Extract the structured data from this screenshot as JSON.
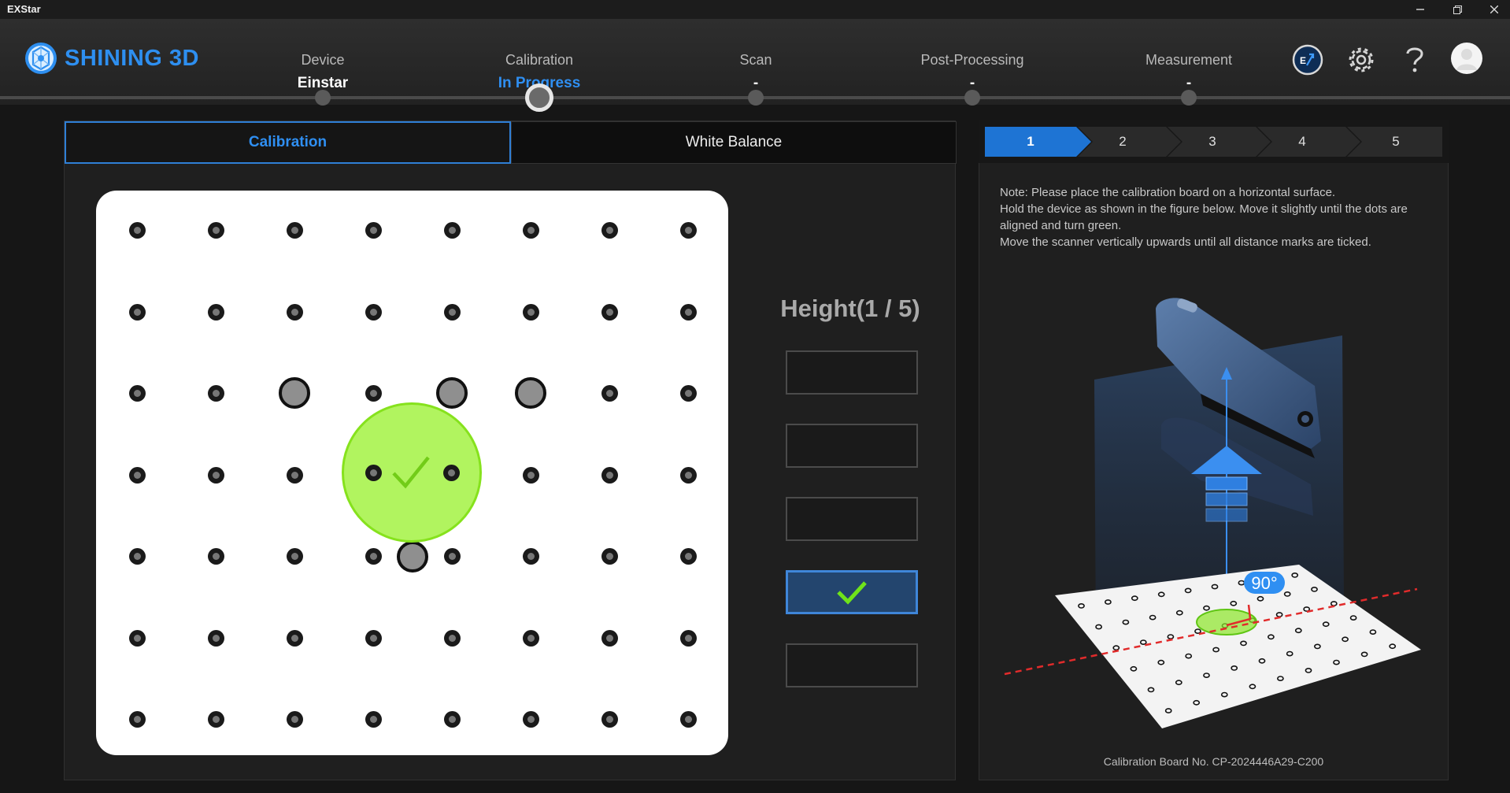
{
  "window": {
    "title": "EXStar",
    "controls": {
      "minimize_icon": "minimize-icon",
      "restore_icon": "restore-icon",
      "close_icon": "close-icon"
    }
  },
  "header": {
    "logo_text": "SHINING 3D",
    "steps": [
      {
        "name": "Device",
        "status": "Einstar",
        "active": false
      },
      {
        "name": "Calibration",
        "status": "In Progress",
        "active": true
      },
      {
        "name": "Scan",
        "status": "-",
        "active": false
      },
      {
        "name": "Post-Processing",
        "status": "-",
        "active": false
      },
      {
        "name": "Measurement",
        "status": "-",
        "active": false
      }
    ],
    "icons": [
      "exmodel-icon",
      "gear-icon",
      "help-icon",
      "avatar-icon"
    ]
  },
  "calibration": {
    "tabs": [
      {
        "label": "Calibration",
        "active": true
      },
      {
        "label": "White Balance",
        "active": false
      }
    ],
    "height_label": "Height(1 / 5)",
    "height_slots": 5,
    "completed_slot": 4,
    "board_grid": {
      "rows": 7,
      "cols": 8
    }
  },
  "guide": {
    "steps": [
      "1",
      "2",
      "3",
      "4",
      "5"
    ],
    "active_step": "1",
    "note_lines": [
      "Note: Please place the calibration board on a horizontal surface.",
      "Hold the device as shown in the figure below. Move it slightly until the dots are aligned and turn green.",
      "Move the scanner vertically upwards until all distance marks are ticked."
    ],
    "angle_label": "90°",
    "board_number": "Calibration Board No. CP-2024446A29-C200"
  },
  "colors": {
    "accent_blue": "#2f8ff2",
    "success_green": "#86e21d",
    "panel_bg": "#1f1f1f"
  }
}
